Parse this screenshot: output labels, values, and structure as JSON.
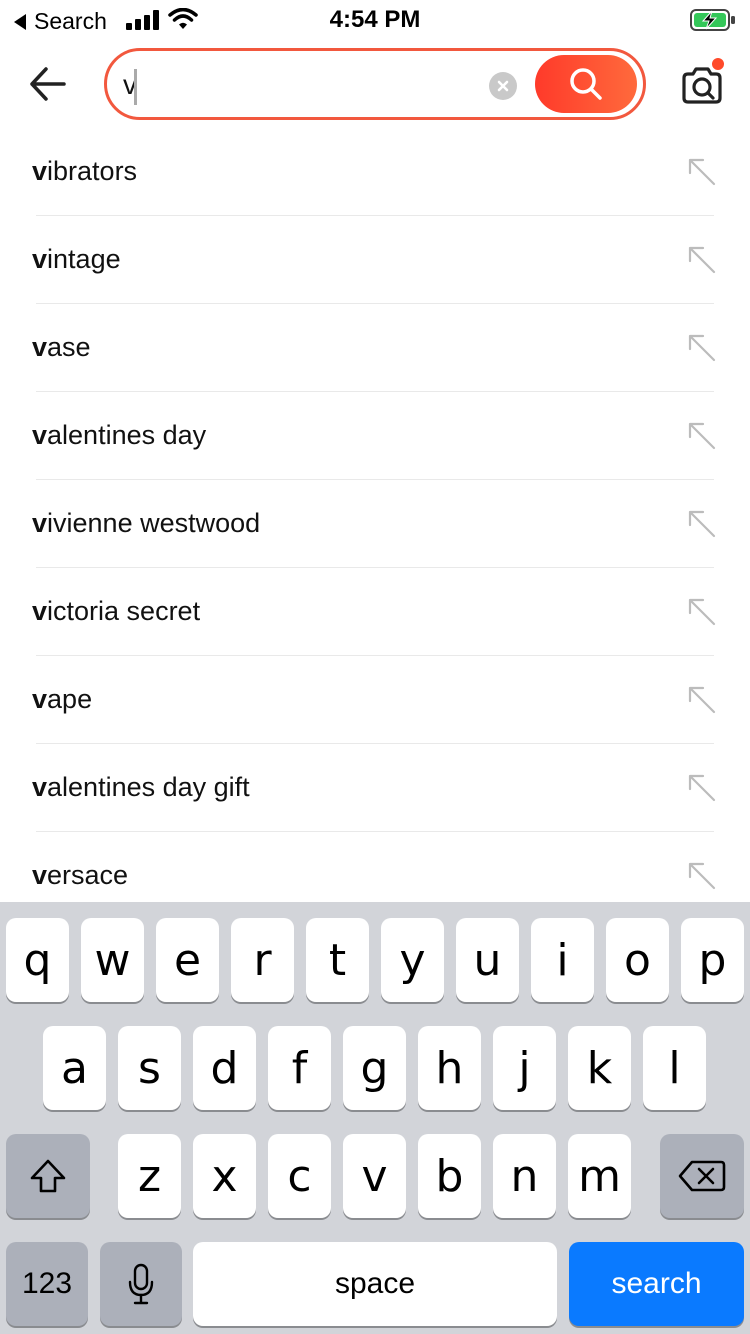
{
  "status_bar": {
    "back_label": "Search",
    "time": "4:54 PM"
  },
  "search": {
    "value": "v",
    "placeholder": "",
    "accent_color": "#f2583e"
  },
  "suggestions": [
    {
      "prefix": "v",
      "rest": "ibrators"
    },
    {
      "prefix": "v",
      "rest": "intage"
    },
    {
      "prefix": "v",
      "rest": "ase"
    },
    {
      "prefix": "v",
      "rest": "alentines day"
    },
    {
      "prefix": "v",
      "rest": "ivienne westwood"
    },
    {
      "prefix": "v",
      "rest": "ictoria secret"
    },
    {
      "prefix": "v",
      "rest": "ape"
    },
    {
      "prefix": "v",
      "rest": "alentines day gift"
    },
    {
      "prefix": "v",
      "rest": "ersace"
    }
  ],
  "keyboard": {
    "row1": [
      "q",
      "w",
      "e",
      "r",
      "t",
      "y",
      "u",
      "i",
      "o",
      "p"
    ],
    "row2": [
      "a",
      "s",
      "d",
      "f",
      "g",
      "h",
      "j",
      "k",
      "l"
    ],
    "row3": [
      "z",
      "x",
      "c",
      "v",
      "b",
      "n",
      "m"
    ],
    "numbers_label": "123",
    "space_label": "space",
    "search_label": "search"
  }
}
